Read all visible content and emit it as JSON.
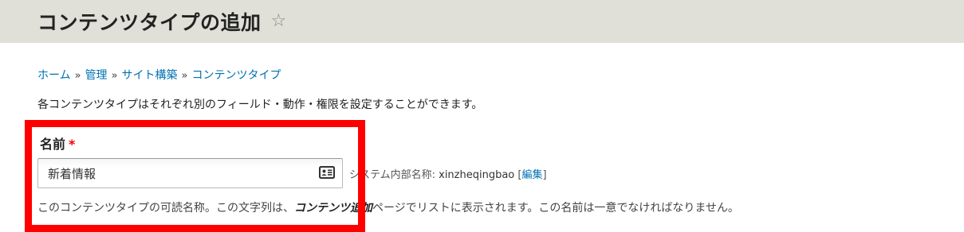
{
  "header": {
    "title": "コンテンツタイプの追加",
    "star_glyph": "☆"
  },
  "breadcrumb": {
    "items": [
      "ホーム",
      "管理",
      "サイト構築",
      "コンテンツタイプ"
    ],
    "separator": "»"
  },
  "description": "各コンテンツタイプはそれぞれ別のフィールド・動作・権限を設定することができます。",
  "form": {
    "name_field": {
      "label": "名前",
      "required_marker": "*",
      "value": "新着情報"
    },
    "machine_name": {
      "prefix": "システム内部名称: ",
      "value": "xinzheqingbao",
      "bracket_open": " [",
      "edit_link": "編集",
      "bracket_close": "]"
    },
    "help": {
      "part1": "このコンテンツタイプの可読名称。この文字列は、",
      "emphasis": "コンテンツ追加",
      "part2": "ページでリストに表示されます。この名前は一意でなければなりません。"
    }
  },
  "colors": {
    "link": "#0071b3",
    "header_bg": "#e0e0d8",
    "highlight": "#ff0000",
    "required": "#ee0000"
  }
}
